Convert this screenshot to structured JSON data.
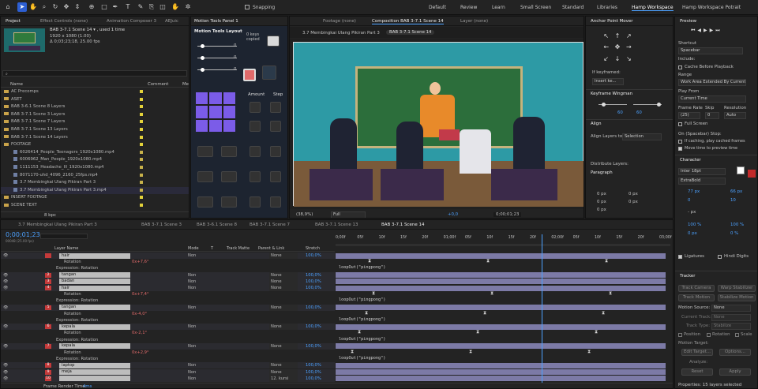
{
  "toolbar": {
    "snapping_label": "Snapping",
    "workspaces": [
      "Default",
      "Review",
      "Learn",
      "Small Screen",
      "Standard",
      "Libraries",
      "Hamp Workspace",
      "Hamp Workspace Potrait"
    ],
    "active_workspace": "Hamp Workspace"
  },
  "project": {
    "tabs": [
      "Project",
      "Effect Controls (none)",
      "Animation Composer 3",
      "AEJuic"
    ],
    "comp_name": "BAB 3-7.1 Scene 14 ▾ , used 1 time",
    "comp_info1": "1920 x 1080 (1.00)",
    "comp_info2": "Δ 0;03;23;18, 25.00 fps",
    "col_name": "Name",
    "col_comment": "Comment",
    "col_media": "Me",
    "items": [
      {
        "type": "folder",
        "name": "AC Precomps",
        "color": "#e3d23a"
      },
      {
        "type": "folder",
        "name": "ASET",
        "color": "#e3d23a"
      },
      {
        "type": "folder",
        "name": "BAB 3-6.1 Scene 8 Layers",
        "color": "#e3d23a"
      },
      {
        "type": "folder",
        "name": "BAB 3-7.1 Scene 3 Layers",
        "color": "#e3d23a"
      },
      {
        "type": "folder",
        "name": "BAB 3-7.1 Scene 7 Layers",
        "color": "#e3d23a"
      },
      {
        "type": "folder",
        "name": "BAB 3-7.1 Scene 13 Layers",
        "color": "#e3d23a"
      },
      {
        "type": "folder",
        "name": "BAB 3-7.1 Scene 14 Layers",
        "color": "#e3d23a"
      },
      {
        "type": "folder",
        "name": "FOOTAGE",
        "color": "#e3d23a"
      },
      {
        "type": "file",
        "name": "6026414_People_Teenagers_1920x1080.mp4",
        "color": "#c8b24a"
      },
      {
        "type": "file",
        "name": "6006962_Man_People_1920x1080.mp4",
        "color": "#c8b24a"
      },
      {
        "type": "file",
        "name": "1111153_Headache_Ill_1920x1080.mp4",
        "color": "#c8b24a"
      },
      {
        "type": "file",
        "name": "8071170-uhd_4096_2160_25fps.mp4",
        "color": "#c8b24a"
      },
      {
        "type": "file",
        "name": "3.7 Membingkai Ulang Pikiran Part 3",
        "color": "#c8b24a"
      },
      {
        "type": "file",
        "name": "3.7 Membingkai Ulang Pikiran Part 3.mp4",
        "color": "#c8b24a"
      },
      {
        "type": "folder",
        "name": "INSERT FOOTAGE",
        "color": "#e3d23a"
      },
      {
        "type": "folder",
        "name": "SCENE TEXT",
        "color": "#e3d23a"
      }
    ],
    "bpc": "8 bpc"
  },
  "motion_tools": {
    "tab": "Motion Tools Panel 1",
    "title": "Motion Tools Layout",
    "keys_copied": "0 keys copied",
    "slider_values": [
      "0",
      "0",
      "0"
    ],
    "amount_label": "Amount",
    "step_label": "Step"
  },
  "viewer": {
    "tabs": [
      "Footage (none)",
      "Composition BAB 3-7.1 Scene 14",
      "Layer (none)"
    ],
    "breadcrumbs": [
      "3.7 Membingkai Ulang Pikiran Part 3",
      "BAB 3-7.1 Scene 14"
    ],
    "zoom": "(38,9%)",
    "resolution": "Full",
    "exposure": "+0,0",
    "timecode": "0;00;01;23"
  },
  "anchor": {
    "tab": "Anchor Point Mover",
    "if_keyframed": "If keyframed:",
    "insert_key": "Insert ke..."
  },
  "wingman": {
    "tab": "Keyframe Wingman",
    "val1": "60",
    "val2": "60"
  },
  "align": {
    "tab": "Align",
    "align_to_label": "Align Layers to:",
    "align_to_value": "Selection",
    "distribute": "Distribute Layers:"
  },
  "paragraph": {
    "tab": "Paragraph",
    "vals": [
      "0 px",
      "0 px",
      "0 px",
      "0 px",
      "0 px"
    ]
  },
  "preview": {
    "tab": "Preview",
    "shortcut_label": "Shortcut",
    "shortcut_value": "Spacebar",
    "include_label": "Include:",
    "cache_label": "Cache Before Playback",
    "range_label": "Range",
    "range_value": "Work Area Extended By Current...",
    "play_from_label": "Play From",
    "play_from_value": "Current Time",
    "fr_label": "Frame Rate",
    "skip_label": "Skip",
    "res_label": "Resolution",
    "fr_value": "(25)",
    "skip_value": "0",
    "res_value": "Auto",
    "full_screen": "Full Screen",
    "on_stop": "On (Spacebar) Stop:",
    "if_caching": "If caching, play cached frames",
    "move_time": "Move time to preview time"
  },
  "character": {
    "tab": "Character",
    "font": "Inter 18pt",
    "style": "ExtraBold",
    "size": "77 px",
    "leading": "66 px",
    "kerning": "0",
    "tracking": "10",
    "stroke": "- px",
    "vscale": "100 %",
    "hscale": "100 %",
    "baseline": "0 px",
    "tsume": "0 %",
    "ligatures": "Ligatures",
    "hindi": "Hindi Digits"
  },
  "tracker": {
    "tab": "Tracker",
    "btns": [
      "Track Camera",
      "Warp Stabilizer",
      "Track Motion",
      "Stabilize Motion"
    ],
    "motion_source_label": "Motion Source:",
    "motion_source_value": "None",
    "current_track_label": "Current Track:",
    "current_track_value": "None",
    "track_type_label": "Track Type:",
    "track_type_value": "Stabilize",
    "position": "Position",
    "rotation": "Rotation",
    "scale": "Scale",
    "motion_target": "Motion Target:",
    "edit_target": "Edit Target...",
    "options": "Options...",
    "analyze": "Analyze:",
    "reset": "Reset",
    "apply": "Apply"
  },
  "properties": "Properties: 15 layers selected",
  "timeline": {
    "tabs": [
      "3.7 Membingkai Ulang Pikiran Part 3",
      "BAB 3-7.1 Scene 3",
      "BAB 3-6.1 Scene 8",
      "BAB 3-7.1 Scene 7",
      "BAB 3-7.1 Scene 13",
      "BAB 3-7.1 Scene 14"
    ],
    "timecode": "0;00;01;23",
    "timecode_sub": "00048 (25.00 fps)",
    "headers": [
      "Layer Name",
      "Mode",
      "T",
      "Track Matte",
      "Parent & Link",
      "Stretch"
    ],
    "ruler": [
      "0;00f",
      "05f",
      "10f",
      "15f",
      "20f",
      "01;00f",
      "05f",
      "10f",
      "15f",
      "20f",
      "02;00f",
      "05f",
      "10f",
      "15f",
      "20f",
      "03;00f"
    ],
    "rows": [
      {
        "kind": "layer",
        "num": "",
        "name": "hair",
        "mode": "Non",
        "parent": "None",
        "stretch": "100,0%"
      },
      {
        "kind": "prop",
        "name": "Rotation",
        "value": "0x+7,6°"
      },
      {
        "kind": "expr",
        "name": "Expression: Rotation",
        "code": "loopOut(\"pingpong\")"
      },
      {
        "kind": "layer",
        "num": "2",
        "name": "tangan",
        "mode": "Non",
        "parent": "None",
        "stretch": "100,0%"
      },
      {
        "kind": "layer",
        "num": "3",
        "name": "badan",
        "mode": "Non",
        "parent": "None",
        "stretch": "100,0%"
      },
      {
        "kind": "layer",
        "num": "4",
        "name": "hair",
        "mode": "Non",
        "parent": "None",
        "stretch": "100,0%"
      },
      {
        "kind": "prop",
        "name": "Rotation",
        "value": "0x+7,4°"
      },
      {
        "kind": "expr",
        "name": "Expression: Rotation",
        "code": "loopOut(\"pingpong\")"
      },
      {
        "kind": "layer",
        "num": "5",
        "name": "tangan",
        "mode": "Non",
        "parent": "None",
        "stretch": "100,0%"
      },
      {
        "kind": "prop",
        "name": "Rotation",
        "value": "0x-4,0°"
      },
      {
        "kind": "expr",
        "name": "Expression: Rotation",
        "code": "loopOut(\"pingpong\")"
      },
      {
        "kind": "layer",
        "num": "6",
        "name": "kepala",
        "mode": "Non",
        "parent": "None",
        "stretch": "100,0%"
      },
      {
        "kind": "prop",
        "name": "Rotation",
        "value": "0x-2,1°"
      },
      {
        "kind": "expr",
        "name": "Expression: Rotation",
        "code": "loopOut(\"pingpong\")"
      },
      {
        "kind": "layer",
        "num": "7",
        "name": "kepala",
        "mode": "Non",
        "parent": "None",
        "stretch": "100,0%"
      },
      {
        "kind": "prop",
        "name": "Rotation",
        "value": "0x+2,9°"
      },
      {
        "kind": "expr",
        "name": "Expression: Rotation",
        "code": "loopOut(\"pingpong\")"
      },
      {
        "kind": "layer",
        "num": "8",
        "name": "laptop",
        "mode": "Non",
        "parent": "None",
        "stretch": "100,0%"
      },
      {
        "kind": "layer",
        "num": "9",
        "name": "meja",
        "mode": "Non",
        "parent": "None",
        "stretch": "100,0%"
      },
      {
        "kind": "layer",
        "num": "10",
        "name": "",
        "mode": "Non",
        "parent": "12. kursi",
        "stretch": "100,0%"
      }
    ],
    "footer": "Frame Render Time:",
    "render_time": "4ms"
  }
}
